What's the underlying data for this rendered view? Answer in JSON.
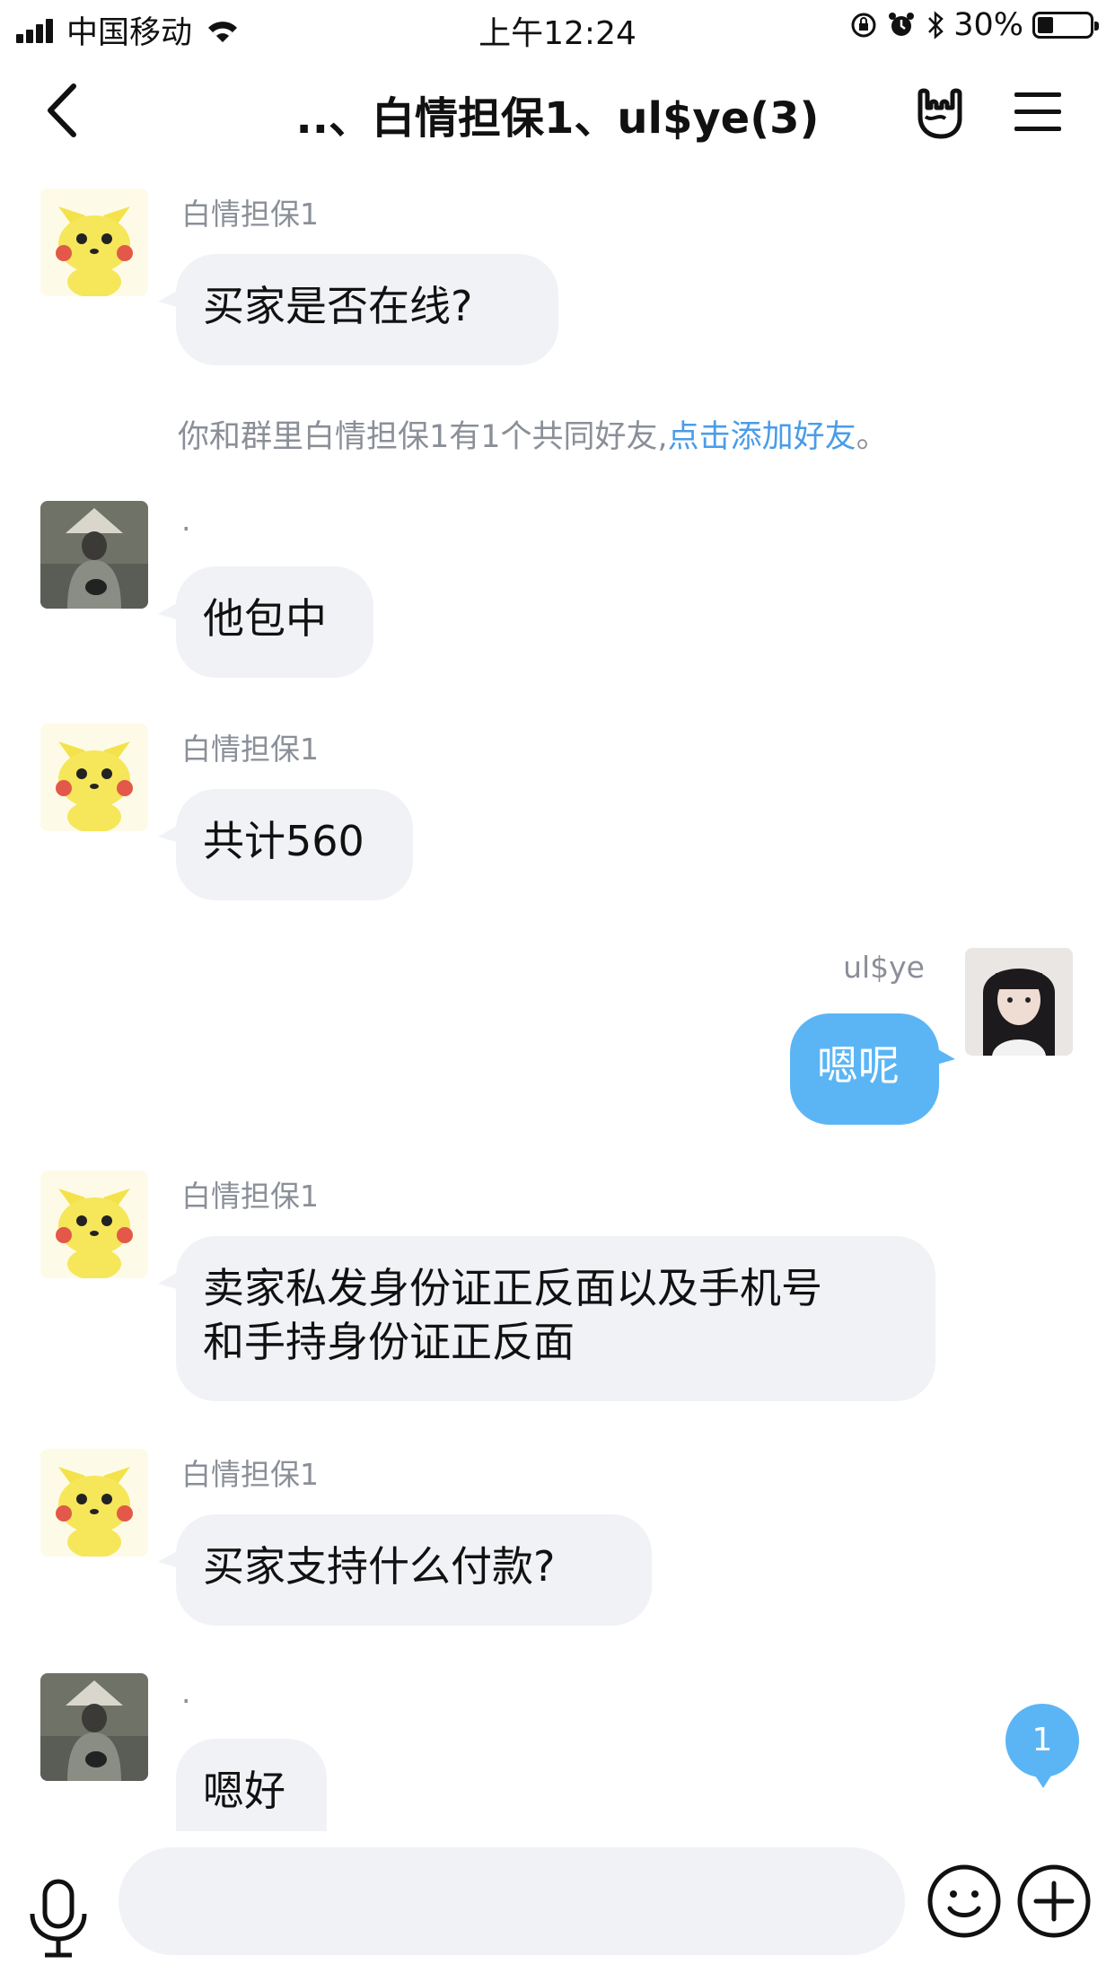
{
  "status_bar": {
    "carrier": "中国移动",
    "time": "上午12:24",
    "battery": "30%",
    "battery_level": 0.3
  },
  "header": {
    "title": "..、白情担保1、ul$ye(3)"
  },
  "messages": [
    {
      "sender": "白情担保1",
      "text": "买家是否在线?"
    },
    {
      "sender": ".",
      "text": "他包中"
    },
    {
      "sender": "白情担保1",
      "text": "共计560"
    },
    {
      "sender": "ul$ye",
      "text": "嗯呢"
    },
    {
      "sender": "白情担保1",
      "line1": "卖家私发身份证正反面以及手机号",
      "line2": "和手持身份证正反面"
    },
    {
      "sender": "白情担保1",
      "text": "买家支持什么付款?"
    },
    {
      "sender": ".",
      "text": "嗯好"
    }
  ],
  "system_notice": {
    "text": "你和群里白情担保1有1个共同好友,",
    "link": "点击添加好友",
    "end": "。"
  },
  "unread_badge": "1",
  "input": {
    "placeholder": ""
  },
  "colors": {
    "accent": "#5bb5f5",
    "bubble_in": "#f1f2f6",
    "link": "#4a9ce8"
  },
  "icons": {
    "back": "chevron-left-icon",
    "gesture": "rock-hand-icon",
    "menu": "hamburger-icon",
    "mic": "microphone-icon",
    "emoji": "smile-icon",
    "plus": "plus-icon"
  }
}
